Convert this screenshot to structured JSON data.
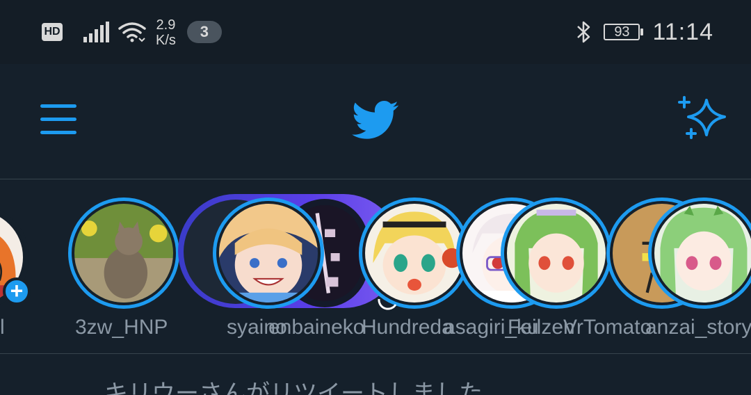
{
  "status_bar": {
    "hd": "HD",
    "net_speed_value": "2.9",
    "net_speed_unit": "K/s",
    "notification_count": "3",
    "battery": "93",
    "time": "11:14"
  },
  "colors": {
    "background": "#15202b",
    "accent": "#1d9bf0",
    "muted_text": "#8b98a5"
  },
  "header": {
    "menu_icon": "hamburger-menu-icon",
    "logo_icon": "twitter-bird-icon",
    "sparkle_icon": "sparkle-icon"
  },
  "fleets": [
    {
      "name": "l",
      "add_label": "+"
    },
    {
      "name": "3zw_HNP"
    },
    {
      "name": "syaino"
    },
    {
      "name": "enbaineko"
    },
    {
      "name": "Hundreda"
    },
    {
      "name": "asagiri_ku"
    },
    {
      "name": "Feilzen"
    },
    {
      "name": "VrTomato"
    },
    {
      "name": "anzai_story"
    }
  ],
  "timeline": {
    "retweet_text": "キリウーさんがリツイートしました"
  }
}
